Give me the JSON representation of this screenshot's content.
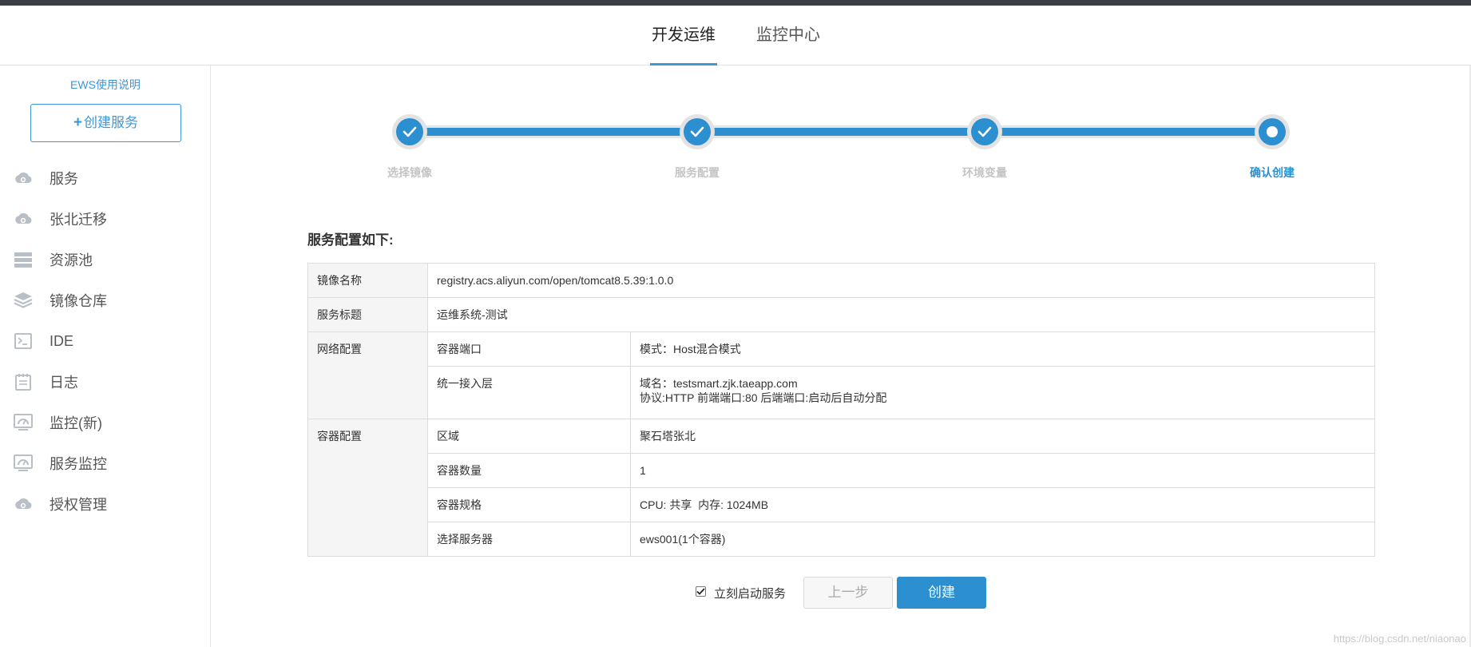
{
  "header": {
    "tabs": [
      {
        "label": "开发运维",
        "active": true
      },
      {
        "label": "监控中心",
        "active": false
      }
    ]
  },
  "sidebar": {
    "help_link": "EWS使用说明",
    "create_button": "创建服务",
    "items": [
      {
        "label": "服务",
        "icon": "cloud-gear-icon"
      },
      {
        "label": "张北迁移",
        "icon": "cloud-gear-icon"
      },
      {
        "label": "资源池",
        "icon": "server-stack-icon"
      },
      {
        "label": "镜像仓库",
        "icon": "layers-icon"
      },
      {
        "label": "IDE",
        "icon": "terminal-icon"
      },
      {
        "label": "日志",
        "icon": "log-icon"
      },
      {
        "label": "监控(新)",
        "icon": "monitor-gauge-icon"
      },
      {
        "label": "服务监控",
        "icon": "monitor-gauge-icon"
      },
      {
        "label": "授权管理",
        "icon": "cloud-gear-icon"
      }
    ]
  },
  "steps": [
    {
      "label": "选择镜像",
      "status": "done"
    },
    {
      "label": "服务配置",
      "status": "done"
    },
    {
      "label": "环境变量",
      "status": "done"
    },
    {
      "label": "确认创建",
      "status": "current"
    }
  ],
  "summary": {
    "title": "服务配置如下:",
    "image_name_label": "镜像名称",
    "image_name_value": "registry.acs.aliyun.com/open/tomcat8.5.39:1.0.0",
    "service_title_label": "服务标题",
    "service_title_value": "运维系统-测试",
    "network_label": "网络配置",
    "container_port_label": "容器端口",
    "container_port_value": "模式：Host混合模式",
    "gateway_label": "统一接入层",
    "gateway_domain": "域名：testsmart.zjk.taeapp.com",
    "gateway_protocol": "协议:HTTP 前端端口:80 后端端口:启动后自动分配",
    "container_label": "容器配置",
    "region_label": "区域",
    "region_value": "聚石塔张北",
    "count_label": "容器数量",
    "count_value": "1",
    "spec_label": "容器规格",
    "spec_value": "CPU: 共享  内存: 1024MB",
    "server_label": "选择服务器",
    "server_value": "ews001(1个容器)"
  },
  "actions": {
    "start_now_label": "立刻启动服务",
    "start_now_checked": true,
    "prev_button": "上一步",
    "create_button": "创建"
  },
  "watermark": "https://blog.csdn.net/niaonao",
  "colors": {
    "accent": "#2b8fd0",
    "link": "#3d97d8",
    "header_strip": "#3b3f45"
  }
}
